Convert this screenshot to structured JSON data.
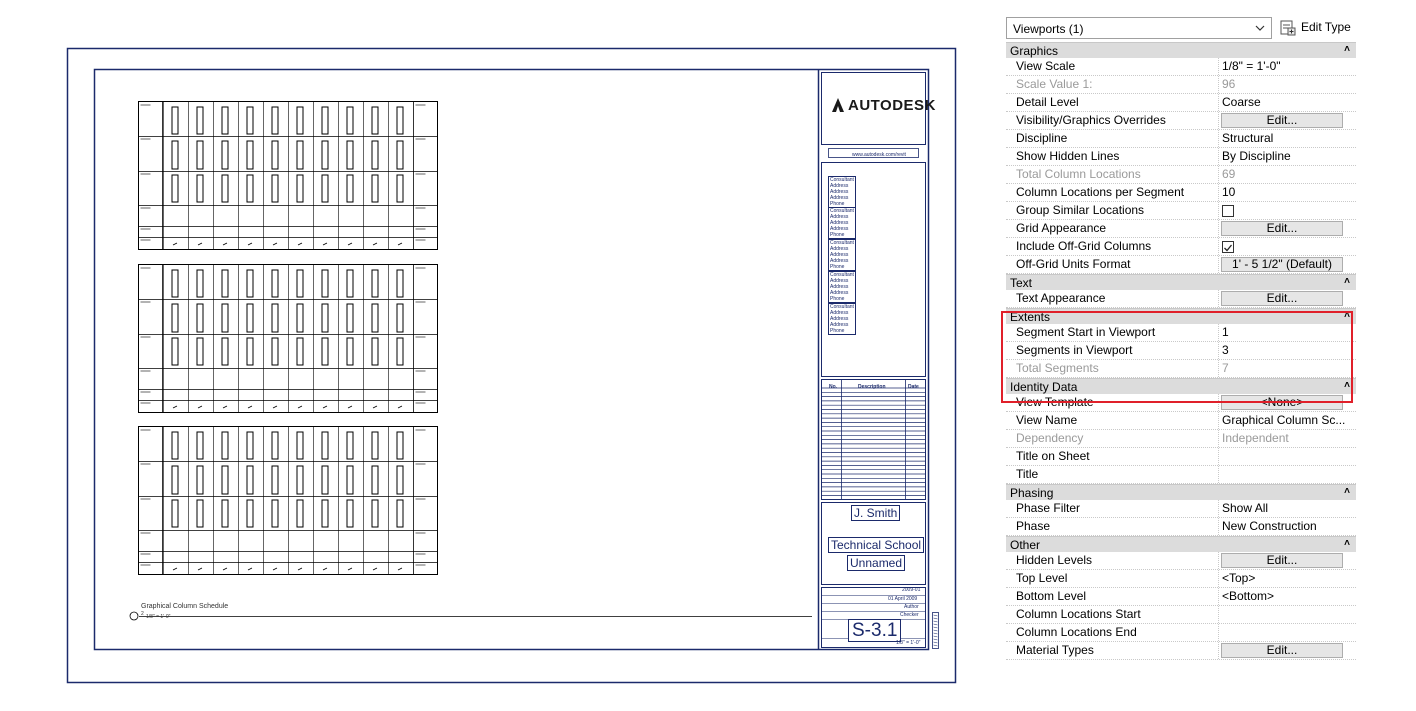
{
  "sheet": {
    "logo_text": "AUTODESK",
    "url": "www.autodesk.com/revit",
    "consultant_lines": [
      "Consultant",
      "Address",
      "Address",
      "Address",
      "Phone"
    ],
    "revision_headers": [
      "No.",
      "Description",
      "Date"
    ],
    "author_name": "J. Smith",
    "project_name": "Technical School",
    "sheet_name": "Unnamed",
    "project_number": "2009-01",
    "date": "01 April 2009",
    "drawn_by": "Author",
    "checked_by": "Checker",
    "sheet_number": "S-3.1",
    "scale": "1/8\" = 1'-0\"",
    "schedule_title": "Graphical Column Schedule",
    "schedule_number": "2",
    "schedule_scale": "1/8\" = 1'-0\""
  },
  "properties": {
    "type_selector": "Viewports (1)",
    "edit_type_label": "Edit Type",
    "groups": [
      {
        "name": "Graphics",
        "rows": [
          {
            "name": "View Scale",
            "value": "1/8\" = 1'-0\"",
            "kind": "text"
          },
          {
            "name": "Scale Value    1:",
            "value": "96",
            "kind": "readonly"
          },
          {
            "name": "Detail Level",
            "value": "Coarse",
            "kind": "text"
          },
          {
            "name": "Visibility/Graphics Overrides",
            "value": "Edit...",
            "kind": "button"
          },
          {
            "name": "Discipline",
            "value": "Structural",
            "kind": "text"
          },
          {
            "name": "Show Hidden Lines",
            "value": "By Discipline",
            "kind": "text"
          },
          {
            "name": "Total Column Locations",
            "value": "69",
            "kind": "readonly"
          },
          {
            "name": "Column Locations per Segment",
            "value": "10",
            "kind": "text"
          },
          {
            "name": "Group Similar Locations",
            "value": "",
            "kind": "checkbox",
            "checked": false
          },
          {
            "name": "Grid Appearance",
            "value": "Edit...",
            "kind": "button"
          },
          {
            "name": "Include Off-Grid Columns",
            "value": "",
            "kind": "checkbox",
            "checked": true
          },
          {
            "name": "Off-Grid Units Format",
            "value": "1' - 5 1/2\" (Default)",
            "kind": "button"
          }
        ]
      },
      {
        "name": "Text",
        "rows": [
          {
            "name": "Text Appearance",
            "value": "Edit...",
            "kind": "button"
          }
        ]
      },
      {
        "name": "Extents",
        "rows": [
          {
            "name": "Segment Start in Viewport",
            "value": "1",
            "kind": "text"
          },
          {
            "name": "Segments in Viewport",
            "value": "3",
            "kind": "text"
          },
          {
            "name": "Total Segments",
            "value": "7",
            "kind": "readonly"
          }
        ]
      },
      {
        "name": "Identity Data",
        "rows": [
          {
            "name": "View Template",
            "value": "<None>",
            "kind": "button"
          },
          {
            "name": "View Name",
            "value": "Graphical Column Sc...",
            "kind": "text"
          },
          {
            "name": "Dependency",
            "value": "Independent",
            "kind": "readonly"
          },
          {
            "name": "Title on Sheet",
            "value": "",
            "kind": "text"
          },
          {
            "name": "Title",
            "value": "",
            "kind": "text"
          }
        ]
      },
      {
        "name": "Phasing",
        "rows": [
          {
            "name": "Phase Filter",
            "value": "Show All",
            "kind": "text"
          },
          {
            "name": "Phase",
            "value": "New Construction",
            "kind": "text"
          }
        ]
      },
      {
        "name": "Other",
        "rows": [
          {
            "name": "Hidden Levels",
            "value": "Edit...",
            "kind": "button"
          },
          {
            "name": "Top Level",
            "value": "<Top>",
            "kind": "text"
          },
          {
            "name": "Bottom Level",
            "value": "<Bottom>",
            "kind": "text"
          },
          {
            "name": "Column Locations Start",
            "value": "",
            "kind": "text"
          },
          {
            "name": "Column Locations End",
            "value": "",
            "kind": "text"
          },
          {
            "name": "Material Types",
            "value": "Edit...",
            "kind": "button"
          }
        ]
      }
    ]
  },
  "colors": {
    "sheet_border": "#1b2a6b",
    "highlight": "#e0202a",
    "group_header": "#dcdcdc"
  }
}
